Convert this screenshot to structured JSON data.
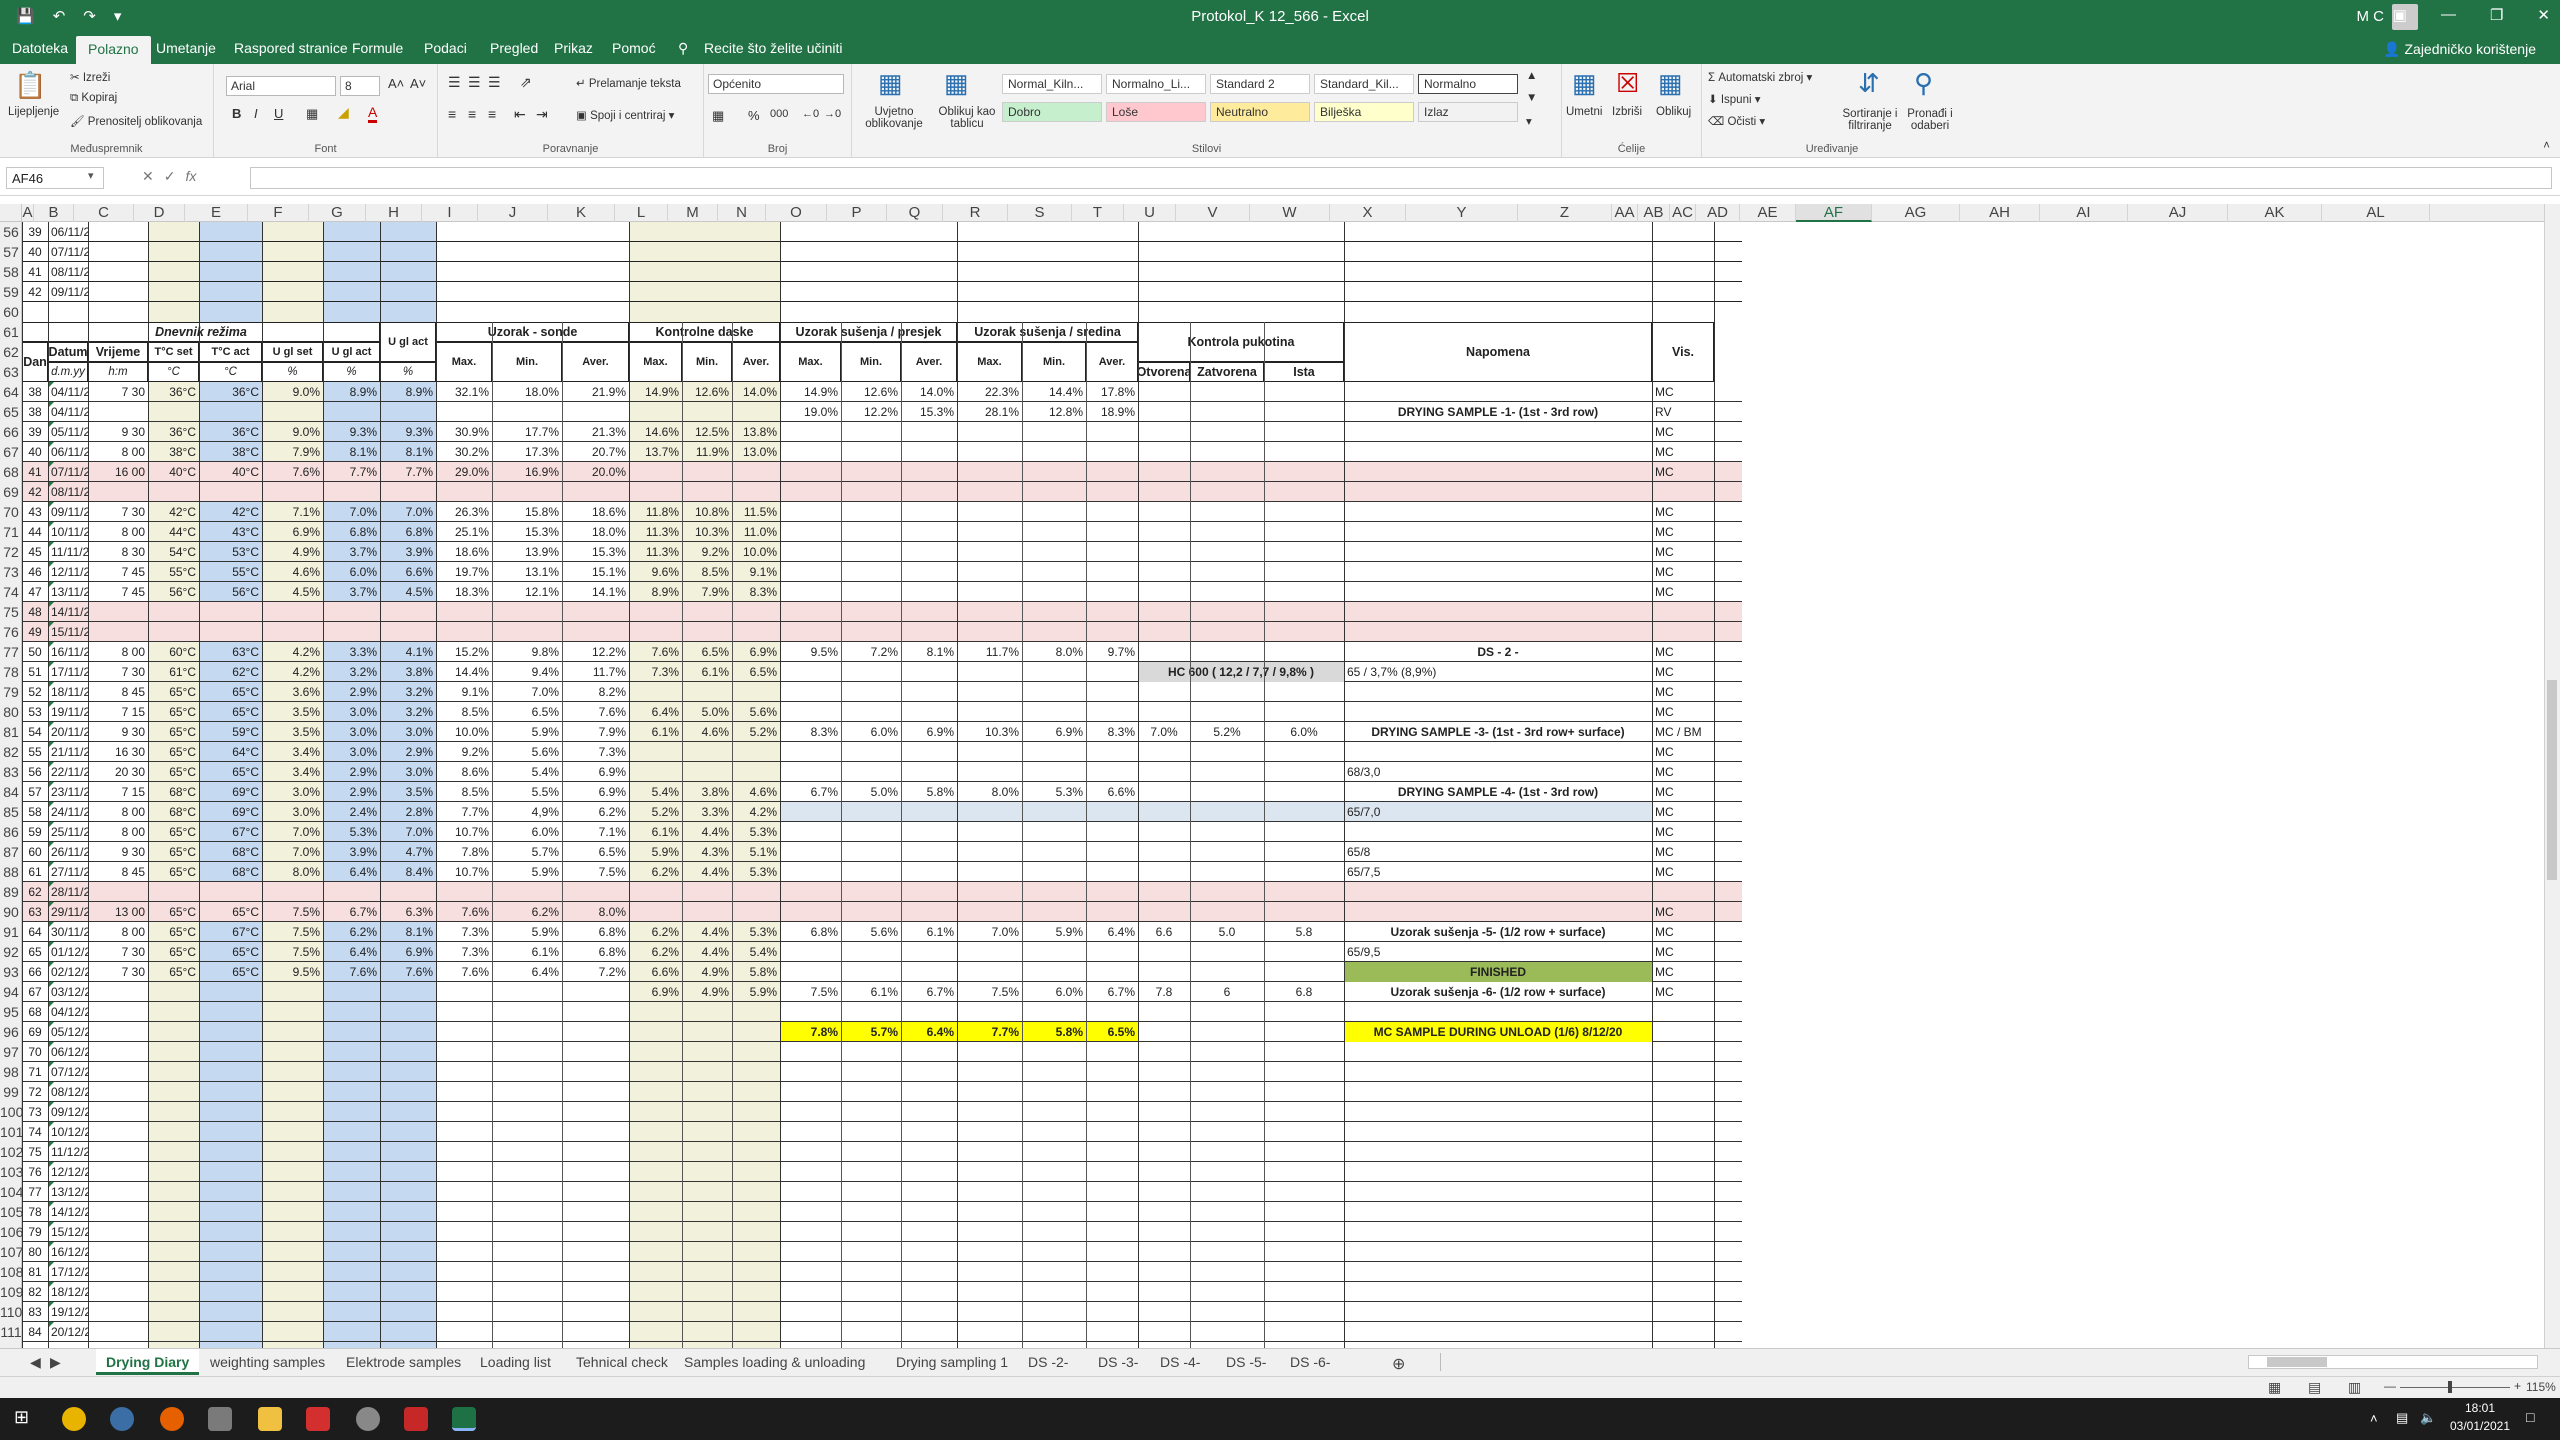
{
  "app": {
    "title": "Protokol_K 12_566  -  Excel",
    "user": "M C",
    "share": "Zajedničko korištenje",
    "search": "Recite što želite učiniti"
  },
  "menu": [
    "Datoteka",
    "Polazno",
    "Umetanje",
    "Raspored stranice",
    "Formule",
    "Podaci",
    "Pregled",
    "Prikaz",
    "Pomoć"
  ],
  "ribbon": {
    "clipboard": {
      "label": "Međuspremnik",
      "paste": "Lijepljenje",
      "cut": "Izreži",
      "copy": "Kopiraj",
      "painter": "Prenositelj oblikovanja"
    },
    "font": {
      "label": "Font",
      "name": "Arial",
      "size": "8"
    },
    "align": {
      "label": "Poravnanje",
      "wrap": "Prelamanje teksta",
      "merge": "Spoji i centriraj"
    },
    "number": {
      "label": "Broj",
      "format": "Općenito"
    },
    "cond": "Uvjetno oblikovanje",
    "astable": "Oblikuj kao tablicu",
    "styles": {
      "label": "Stilovi",
      "items": [
        [
          "Normal_Kiln...",
          "#ffffff"
        ],
        [
          "Normalno_Li...",
          "#ffffff"
        ],
        [
          "Standard 2",
          "#ffffff"
        ],
        [
          "Standard_Kil...",
          "#ffffff"
        ],
        [
          "Normalno",
          "#ffffff"
        ],
        [
          "Dobro",
          "#c6efce"
        ],
        [
          "Loše",
          "#ffc7ce"
        ],
        [
          "Neutralno",
          "#ffeb9c"
        ],
        [
          "Bilješka",
          "#ffffcc"
        ],
        [
          "Izlaz",
          "#f2f2f2"
        ]
      ]
    },
    "cells": {
      "label": "Ćelije",
      "insert": "Umetni",
      "delete": "Izbriši",
      "format": "Oblikuj"
    },
    "editing": {
      "label": "Uređivanje",
      "autosum": "Automatski zbroj",
      "fill": "Ispuni",
      "clear": "Očisti",
      "sort": "Sortiranje i filtriranje",
      "find": "Pronađi i odaberi"
    }
  },
  "namebox": "AF46",
  "columns": [
    "A",
    "B",
    "C",
    "D",
    "E",
    "F",
    "G",
    "H",
    "I",
    "J",
    "K",
    "L",
    "M",
    "N",
    "O",
    "P",
    "Q",
    "R",
    "S",
    "T",
    "U",
    "V",
    "W",
    "X",
    "Y",
    "Z",
    "AA",
    "AB",
    "AC",
    "AD",
    "AE",
    "AF",
    "AG",
    "AH",
    "AI",
    "AJ",
    "AK",
    "AL"
  ],
  "rows_top": [
    [
      "56",
      "39",
      "06/11/20"
    ],
    [
      "57",
      "40",
      "07/11/20"
    ],
    [
      "58",
      "41",
      "08/11/20"
    ],
    [
      "59",
      "42",
      "09/11/20"
    ],
    [
      "60",
      "",
      ""
    ]
  ],
  "headers": {
    "dnevnik": "Dnevnik režima",
    "uzorak_sonde": "Uzorak - sonde",
    "kontrolne": "Kontrolne daske",
    "presjek": "Uzorak sušenja / presjek",
    "sredina": "Uzorak sušenja / sredina",
    "pukotina": "Kontrola pukotina",
    "napomena": "Napomena",
    "vis": "Vis.",
    "dan": "Dan",
    "datum": "Datum",
    "vrijeme": "Vrijeme",
    "tset": "T°C set",
    "tact": "T°C act",
    "uset": "U gl set",
    "uact1": "U gl act",
    "uact2": "U gl act",
    "max": "Max.",
    "min": "Min.",
    "aver": "Aver.",
    "otvorena": "Otvorena",
    "zatvorena": "Zatvorena",
    "ista": "Ista",
    "u1": "d.m.yy",
    "u2": "h:m",
    "u3": "°C",
    "u4": "°C",
    "u5": "%",
    "u6": "%",
    "u7": "%"
  },
  "rows": [
    [
      "64",
      "38",
      "04/11/20",
      "7 30",
      "36°C",
      "36°C",
      "9.0%",
      "8.9%",
      "8.9%",
      "32.1%",
      "18.0%",
      "21.9%",
      "14.9%",
      "12.6%",
      "14.0%",
      "14.9%",
      "12.6%",
      "14.0%",
      "22.3%",
      "14.4%",
      "17.8%",
      "",
      "",
      "",
      "",
      "MC"
    ],
    [
      "65",
      "38",
      "04/11/20",
      "",
      "",
      "",
      "",
      "",
      "",
      "",
      "",
      "",
      "",
      "",
      "",
      "19.0%",
      "12.2%",
      "15.3%",
      "28.1%",
      "12.8%",
      "18.9%",
      "",
      "",
      "",
      "DRYING SAMPLE -1- (1st - 3rd row)",
      "RV"
    ],
    [
      "66",
      "39",
      "05/11/20",
      "9 30",
      "36°C",
      "36°C",
      "9.0%",
      "9.3%",
      "9.3%",
      "30.9%",
      "17.7%",
      "21.3%",
      "14.6%",
      "12.5%",
      "13.8%",
      "",
      "",
      "",
      "",
      "",
      "",
      "",
      "",
      "",
      "",
      "MC"
    ],
    [
      "67",
      "40",
      "06/11/20",
      "8 00",
      "38°C",
      "38°C",
      "7.9%",
      "8.1%",
      "8.1%",
      "30.2%",
      "17.3%",
      "20.7%",
      "13.7%",
      "11.9%",
      "13.0%",
      "",
      "",
      "",
      "",
      "",
      "",
      "",
      "",
      "",
      "",
      "MC"
    ],
    [
      "68",
      "41",
      "07/11/20",
      "16 00",
      "40°C",
      "40°C",
      "7.6%",
      "7.7%",
      "7.7%",
      "29.0%",
      "16.9%",
      "20.0%",
      "",
      "",
      "",
      "",
      "",
      "",
      "",
      "",
      "",
      "",
      "",
      "",
      "",
      "MC"
    ],
    [
      "69",
      "42",
      "08/11/20",
      "",
      "",
      "",
      "",
      "",
      "",
      "",
      "",
      "",
      "",
      "",
      "",
      "",
      "",
      "",
      "",
      "",
      "",
      "",
      "",
      "",
      "",
      ""
    ],
    [
      "70",
      "43",
      "09/11/20",
      "7 30",
      "42°C",
      "42°C",
      "7.1%",
      "7.0%",
      "7.0%",
      "26.3%",
      "15.8%",
      "18.6%",
      "11.8%",
      "10.8%",
      "11.5%",
      "",
      "",
      "",
      "",
      "",
      "",
      "",
      "",
      "",
      "",
      "MC"
    ],
    [
      "71",
      "44",
      "10/11/20",
      "8 00",
      "44°C",
      "43°C",
      "6.9%",
      "6.8%",
      "6.8%",
      "25.1%",
      "15.3%",
      "18.0%",
      "11.3%",
      "10.3%",
      "11.0%",
      "",
      "",
      "",
      "",
      "",
      "",
      "",
      "",
      "",
      "",
      "MC"
    ],
    [
      "72",
      "45",
      "11/11/20",
      "8 30",
      "54°C",
      "53°C",
      "4.9%",
      "3.7%",
      "3.9%",
      "18.6%",
      "13.9%",
      "15.3%",
      "11.3%",
      "9.2%",
      "10.0%",
      "",
      "",
      "",
      "",
      "",
      "",
      "",
      "",
      "",
      "",
      "MC"
    ],
    [
      "73",
      "46",
      "12/11/20",
      "7 45",
      "55°C",
      "55°C",
      "4.6%",
      "6.0%",
      "6.6%",
      "19.7%",
      "13.1%",
      "15.1%",
      "9.6%",
      "8.5%",
      "9.1%",
      "",
      "",
      "",
      "",
      "",
      "",
      "",
      "",
      "",
      "",
      "MC"
    ],
    [
      "74",
      "47",
      "13/11/20",
      "7 45",
      "56°C",
      "56°C",
      "4.5%",
      "3.7%",
      "4.5%",
      "18.3%",
      "12.1%",
      "14.1%",
      "8.9%",
      "7.9%",
      "8.3%",
      "",
      "",
      "",
      "",
      "",
      "",
      "",
      "",
      "",
      "",
      "MC"
    ],
    [
      "75",
      "48",
      "14/11/20",
      "",
      "",
      "",
      "",
      "",
      "",
      "",
      "",
      "",
      "",
      "",
      "",
      "",
      "",
      "",
      "",
      "",
      "",
      "",
      "",
      "",
      "",
      ""
    ],
    [
      "76",
      "49",
      "15/11/20",
      "",
      "",
      "",
      "",
      "",
      "",
      "",
      "",
      "",
      "",
      "",
      "",
      "",
      "",
      "",
      "",
      "",
      "",
      "",
      "",
      "",
      "",
      ""
    ],
    [
      "77",
      "50",
      "16/11/20",
      "8 00",
      "60°C",
      "63°C",
      "4.2%",
      "3.3%",
      "4.1%",
      "15.2%",
      "9.8%",
      "12.2%",
      "7.6%",
      "6.5%",
      "6.9%",
      "9.5%",
      "7.2%",
      "8.1%",
      "11.7%",
      "8.0%",
      "9.7%",
      "",
      "",
      "",
      "DS - 2 -",
      "MC"
    ],
    [
      "78",
      "51",
      "17/11/20",
      "7 30",
      "61°C",
      "62°C",
      "4.2%",
      "3.2%",
      "3.8%",
      "14.4%",
      "9.4%",
      "11.7%",
      "7.3%",
      "6.1%",
      "6.5%",
      "",
      "",
      "",
      "",
      "",
      "",
      "HC 600 ( 12,2 / 7,7 / 9,8% )",
      "",
      "",
      "65 / 3,7%  (8,9%)",
      "MC"
    ],
    [
      "79",
      "52",
      "18/11/20",
      "8 45",
      "65°C",
      "65°C",
      "3.6%",
      "2.9%",
      "3.2%",
      "9.1%",
      "7.0%",
      "8.2%",
      "",
      "",
      "",
      "",
      "",
      "",
      "",
      "",
      "",
      "",
      "",
      "",
      "",
      "MC"
    ],
    [
      "80",
      "53",
      "19/11/20",
      "7 15",
      "65°C",
      "65°C",
      "3.5%",
      "3.0%",
      "3.2%",
      "8.5%",
      "6.5%",
      "7.6%",
      "6.4%",
      "5.0%",
      "5.6%",
      "",
      "",
      "",
      "",
      "",
      "",
      "",
      "",
      "",
      "",
      "MC"
    ],
    [
      "81",
      "54",
      "20/11/20",
      "9 30",
      "65°C",
      "59°C",
      "3.5%",
      "3.0%",
      "3.0%",
      "10.0%",
      "5.9%",
      "7.9%",
      "6.1%",
      "4.6%",
      "5.2%",
      "8.3%",
      "6.0%",
      "6.9%",
      "10.3%",
      "6.9%",
      "8.3%",
      "7.0%",
      "5.2%",
      "6.0%",
      "DRYING SAMPLE -3- (1st - 3rd row+ surface)",
      "MC / BM"
    ],
    [
      "82",
      "55",
      "21/11/20",
      "16 30",
      "65°C",
      "64°C",
      "3.4%",
      "3.0%",
      "2.9%",
      "9.2%",
      "5.6%",
      "7.3%",
      "",
      "",
      "",
      "",
      "",
      "",
      "",
      "",
      "",
      "",
      "",
      "",
      "",
      "MC"
    ],
    [
      "83",
      "56",
      "22/11/20",
      "20 30",
      "65°C",
      "65°C",
      "3.4%",
      "2.9%",
      "3.0%",
      "8.6%",
      "5.4%",
      "6.9%",
      "",
      "",
      "",
      "",
      "",
      "",
      "",
      "",
      "",
      "",
      "",
      "",
      "68/3,0",
      "MC"
    ],
    [
      "84",
      "57",
      "23/11/20",
      "7 15",
      "68°C",
      "69°C",
      "3.0%",
      "2.9%",
      "3.5%",
      "8.5%",
      "5.5%",
      "6.9%",
      "5.4%",
      "3.8%",
      "4.6%",
      "6.7%",
      "5.0%",
      "5.8%",
      "8.0%",
      "5.3%",
      "6.6%",
      "",
      "",
      "",
      "DRYING SAMPLE -4- (1st - 3rd row)",
      "MC"
    ],
    [
      "85",
      "58",
      "24/11/20",
      "8 00",
      "68°C",
      "69°C",
      "3.0%",
      "2.4%",
      "2.8%",
      "7.7%",
      "4,9%",
      "6.2%",
      "5.2%",
      "3.3%",
      "4.2%",
      "",
      "",
      "",
      "",
      "",
      "",
      "",
      "",
      "",
      "65/7,0",
      "MC"
    ],
    [
      "86",
      "59",
      "25/11/20",
      "8 00",
      "65°C",
      "67°C",
      "7.0%",
      "5.3%",
      "7.0%",
      "10.7%",
      "6.0%",
      "7.1%",
      "6.1%",
      "4.4%",
      "5.3%",
      "",
      "",
      "",
      "",
      "",
      "",
      "",
      "",
      "",
      "",
      "MC"
    ],
    [
      "87",
      "60",
      "26/11/20",
      "9 30",
      "65°C",
      "68°C",
      "7.0%",
      "3.9%",
      "4.7%",
      "7.8%",
      "5.7%",
      "6.5%",
      "5.9%",
      "4.3%",
      "5.1%",
      "",
      "",
      "",
      "",
      "",
      "",
      "",
      "",
      "",
      "65/8",
      "MC"
    ],
    [
      "88",
      "61",
      "27/11/20",
      "8 45",
      "65°C",
      "68°C",
      "8.0%",
      "6.4%",
      "8.4%",
      "10.7%",
      "5.9%",
      "7.5%",
      "6.2%",
      "4.4%",
      "5.3%",
      "",
      "",
      "",
      "",
      "",
      "",
      "",
      "",
      "",
      "65/7,5",
      "MC"
    ],
    [
      "89",
      "62",
      "28/11/20",
      "",
      "",
      "",
      "",
      "",
      "",
      "",
      "",
      "",
      "",
      "",
      "",
      "",
      "",
      "",
      "",
      "",
      "",
      "",
      "",
      "",
      "",
      ""
    ],
    [
      "90",
      "63",
      "29/11/20",
      "13 00",
      "65°C",
      "65°C",
      "7.5%",
      "6.7%",
      "6.3%",
      "7.6%",
      "6.2%",
      "8.0%",
      "",
      "",
      "",
      "",
      "",
      "",
      "",
      "",
      "",
      "",
      "",
      "",
      "",
      "MC"
    ],
    [
      "91",
      "64",
      "30/11/20",
      "8 00",
      "65°C",
      "67°C",
      "7.5%",
      "6.2%",
      "8.1%",
      "7.3%",
      "5.9%",
      "6.8%",
      "6.2%",
      "4.4%",
      "5.3%",
      "6.8%",
      "5.6%",
      "6.1%",
      "7.0%",
      "5.9%",
      "6.4%",
      "6.6",
      "5.0",
      "5.8",
      "Uzorak sušenja -5- (1/2 row + surface)",
      "MC"
    ],
    [
      "92",
      "65",
      "01/12/20",
      "7 30",
      "65°C",
      "65°C",
      "7.5%",
      "6.4%",
      "6.9%",
      "7.3%",
      "6.1%",
      "6.8%",
      "6.2%",
      "4.4%",
      "5.4%",
      "",
      "",
      "",
      "",
      "",
      "",
      "",
      "",
      "",
      "65/9,5",
      "MC"
    ],
    [
      "93",
      "66",
      "02/12/20",
      "7 30",
      "65°C",
      "65°C",
      "9.5%",
      "7.6%",
      "7.6%",
      "7.6%",
      "6.4%",
      "7.2%",
      "6.6%",
      "4.9%",
      "5.8%",
      "",
      "",
      "",
      "",
      "",
      "",
      "",
      "",
      "",
      "FINISHED",
      "MC"
    ],
    [
      "94",
      "67",
      "03/12/20",
      "",
      "",
      "",
      "",
      "",
      "",
      "",
      "",
      "",
      "6.9%",
      "4.9%",
      "5.9%",
      "7.5%",
      "6.1%",
      "6.7%",
      "7.5%",
      "6.0%",
      "6.7%",
      "7.8",
      "6",
      "6.8",
      "Uzorak sušenja -6- (1/2 row + surface)",
      "MC"
    ],
    [
      "95",
      "68",
      "04/12/20",
      "",
      "",
      "",
      "",
      "",
      "",
      "",
      "",
      "",
      "",
      "",
      "",
      "",
      "",
      "",
      "",
      "",
      "",
      "",
      "",
      "",
      "",
      ""
    ],
    [
      "96",
      "69",
      "05/12/20",
      "",
      "",
      "",
      "",
      "",
      "",
      "",
      "",
      "",
      "",
      "",
      "",
      "7.8%",
      "5.7%",
      "6.4%",
      "7.7%",
      "5.8%",
      "6.5%",
      "",
      "",
      "",
      "MC SAMPLE DURING UNLOAD (1/6) 8/12/20",
      ""
    ],
    [
      "97",
      "70",
      "06/12/20"
    ],
    [
      "98",
      "71",
      "07/12/20"
    ],
    [
      "99",
      "72",
      "08/12/20"
    ],
    [
      "100",
      "73",
      "09/12/20"
    ],
    [
      "101",
      "74",
      "10/12/20"
    ],
    [
      "102",
      "75",
      "11/12/20"
    ],
    [
      "103",
      "76",
      "12/12/20"
    ],
    [
      "104",
      "77",
      "13/12/20"
    ],
    [
      "105",
      "78",
      "14/12/20"
    ],
    [
      "106",
      "79",
      "15/12/20"
    ],
    [
      "107",
      "80",
      "16/12/20"
    ],
    [
      "108",
      "81",
      "17/12/20"
    ],
    [
      "109",
      "82",
      "18/12/20"
    ],
    [
      "110",
      "83",
      "19/12/20"
    ],
    [
      "111",
      "84",
      "20/12/20"
    ]
  ],
  "header_rows": [
    "61",
    "62",
    "63"
  ],
  "colors": {
    "excel_green": "#217346",
    "col_yellow": "#f2f1dc",
    "col_blue": "#c5d9f1",
    "row_pink": "#f8dfdf",
    "row_blue": "#dce6f1",
    "note_green": "#9bbb59",
    "note_yellow": "#ffff00",
    "note_gray": "#d9d9d9"
  },
  "sheets": [
    "Drying Diary",
    "weighting samples",
    "Elektrode samples",
    "Loading list",
    "Tehnical check",
    "Samples loading & unloading",
    "Drying sampling 1",
    "DS -2-",
    "DS -3-",
    "DS -4-",
    "DS -5-",
    "DS -6-"
  ],
  "status": {
    "zoom": "115%"
  },
  "taskbar": {
    "time": "18:01",
    "date": "03/01/2021"
  }
}
